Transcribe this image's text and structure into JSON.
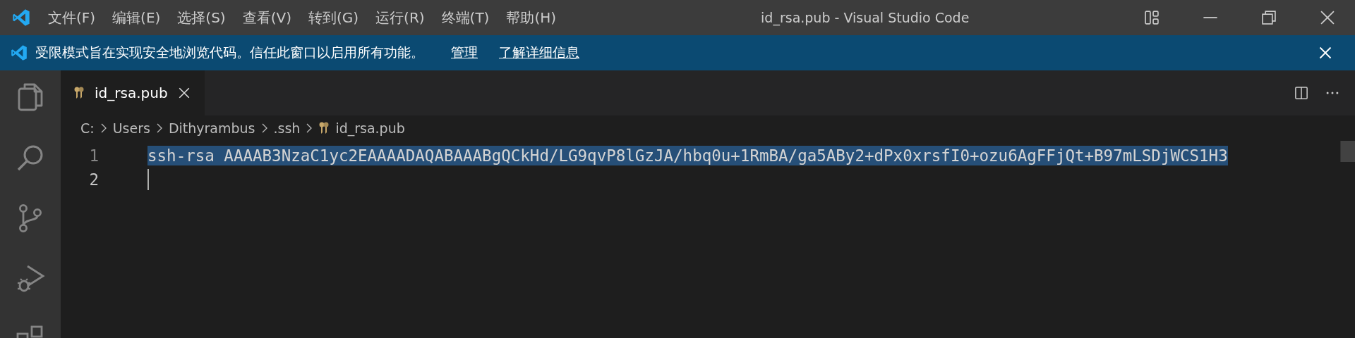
{
  "window": {
    "title": "id_rsa.pub - Visual Studio Code"
  },
  "menu": [
    "文件(F)",
    "编辑(E)",
    "选择(S)",
    "查看(V)",
    "转到(G)",
    "运行(R)",
    "终端(T)",
    "帮助(H)"
  ],
  "banner": {
    "message": "受限模式旨在实现安全地浏览代码。信任此窗口以启用所有功能。",
    "links": [
      "管理",
      "了解详细信息"
    ]
  },
  "tabs": [
    {
      "label": "id_rsa.pub",
      "selected": true
    }
  ],
  "breadcrumb": [
    "C:",
    "Users",
    "Dithyrambus",
    ".ssh",
    "id_rsa.pub"
  ],
  "lines": [
    {
      "number": "1",
      "text": "ssh-rsa AAAAB3NzaC1yc2EAAAADAQABAAABgQCkHd/LG9qvP8lGzJA/hbq0u+1RmBA/ga5ABy2+dPx0xrsfI0+ozu6AgFFjQt+B97mLSDjWCS1H3",
      "selected": true,
      "current": false
    },
    {
      "number": "2",
      "selected": false,
      "current": true
    }
  ]
}
